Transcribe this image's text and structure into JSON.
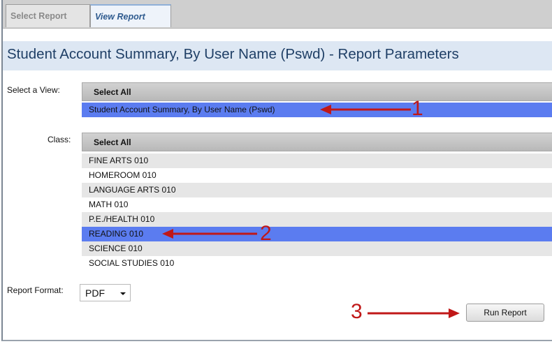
{
  "tabs": [
    {
      "label": "Select Report"
    },
    {
      "label": "View Report"
    }
  ],
  "page": {
    "title": "Student Account Summary, By User Name (Pswd) - Report Parameters"
  },
  "view": {
    "label": "Select a View:",
    "header": "Select All",
    "options": [
      "Student Account Summary, By User Name (Pswd)"
    ]
  },
  "class": {
    "label": "Class:",
    "header": "Select All",
    "options": [
      "FINE ARTS 010",
      "HOMEROOM 010",
      "LANGUAGE ARTS 010",
      "MATH 010",
      "P.E./HEALTH 010",
      "READING 010",
      "SCIENCE 010",
      "SOCIAL STUDIES 010"
    ],
    "selected": "READING 010"
  },
  "format": {
    "label": "Report Format:",
    "value": "PDF"
  },
  "run": {
    "label": "Run Report"
  },
  "callouts": [
    "1",
    "2",
    "3"
  ],
  "colors": {
    "selection": "#5b7cf0",
    "title": "#1f3f66",
    "callout": "#c01818"
  }
}
